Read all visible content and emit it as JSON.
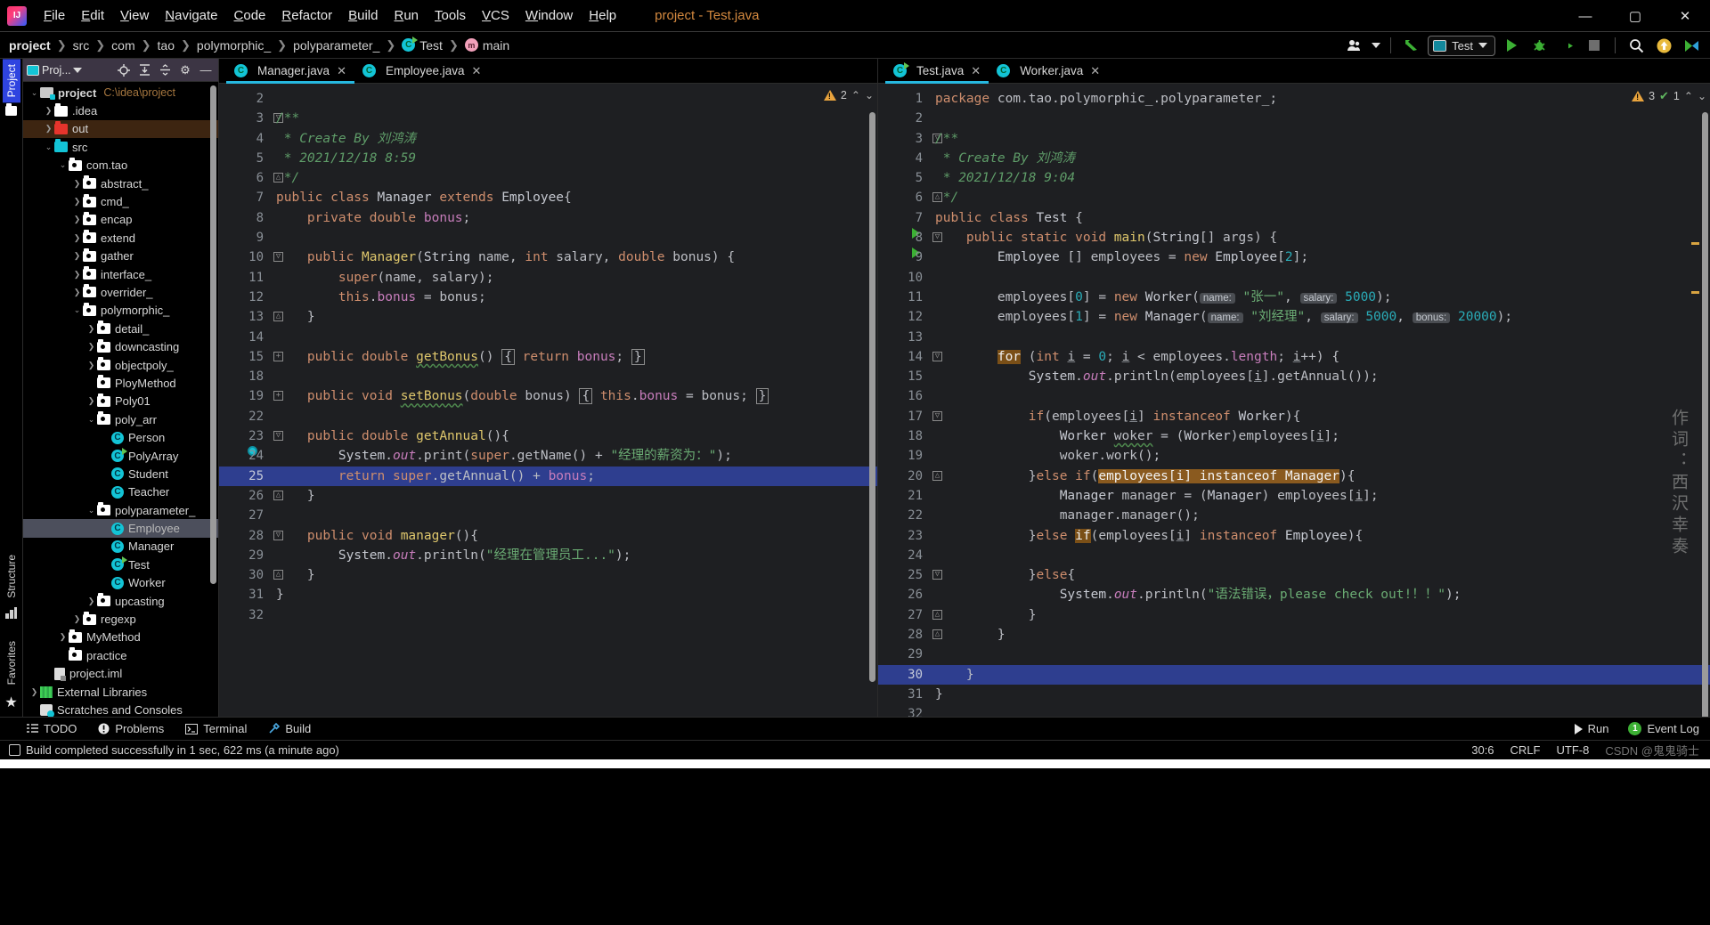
{
  "window": {
    "title": "project - Test.java",
    "app_icon": "intellij-logo",
    "minimize": "—",
    "maximize": "▢",
    "close": "✕"
  },
  "menu": [
    "File",
    "Edit",
    "View",
    "Navigate",
    "Code",
    "Refactor",
    "Build",
    "Run",
    "Tools",
    "VCS",
    "Window",
    "Help"
  ],
  "breadcrumb": [
    "project",
    "src",
    "com",
    "tao",
    "polymorphic_",
    "polyparameter_",
    "Test",
    "main"
  ],
  "toolbar": {
    "vcs_label": "",
    "run_config": "Test",
    "run_button": "run-button",
    "debug_button": "debug-button",
    "coverage_button": "run-with-coverage-button",
    "stop_button": "stop-button",
    "search_button": "search-everywhere-button",
    "update_button": "update-project-button",
    "settings_button": "ide-settings-button"
  },
  "left_strip": {
    "top": [
      "Project"
    ],
    "bottom": [
      "Structure",
      "Favorites"
    ]
  },
  "project_panel": {
    "title": "Proj...",
    "icons": [
      "locate-icon",
      "expand-all-icon",
      "collapse-all-icon",
      "settings-icon",
      "hide-icon"
    ],
    "tree": [
      {
        "label": "project",
        "suffix": "C:\\idea\\project",
        "indent": 0,
        "arrow": "v",
        "icon": "module",
        "state": "normal"
      },
      {
        "label": ".idea",
        "indent": 1,
        "arrow": ">",
        "icon": "folder-plain",
        "state": "normal"
      },
      {
        "label": "out",
        "indent": 1,
        "arrow": ">",
        "icon": "folder-red",
        "state": "selected-out"
      },
      {
        "label": "src",
        "indent": 1,
        "arrow": "v",
        "icon": "folder-cyan",
        "state": "normal"
      },
      {
        "label": "com.tao",
        "indent": 2,
        "arrow": "v",
        "icon": "package",
        "state": "normal"
      },
      {
        "label": "abstract_",
        "indent": 3,
        "arrow": ">",
        "icon": "package",
        "state": "normal"
      },
      {
        "label": "cmd_",
        "indent": 3,
        "arrow": ">",
        "icon": "package",
        "state": "normal"
      },
      {
        "label": "encap",
        "indent": 3,
        "arrow": ">",
        "icon": "package",
        "state": "normal"
      },
      {
        "label": "extend",
        "indent": 3,
        "arrow": ">",
        "icon": "package",
        "state": "normal"
      },
      {
        "label": "gather",
        "indent": 3,
        "arrow": ">",
        "icon": "package",
        "state": "normal"
      },
      {
        "label": "interface_",
        "indent": 3,
        "arrow": ">",
        "icon": "package",
        "state": "normal"
      },
      {
        "label": "overrider_",
        "indent": 3,
        "arrow": ">",
        "icon": "package",
        "state": "normal"
      },
      {
        "label": "polymorphic_",
        "indent": 3,
        "arrow": "v",
        "icon": "package",
        "state": "normal"
      },
      {
        "label": "detail_",
        "indent": 4,
        "arrow": ">",
        "icon": "package",
        "state": "normal"
      },
      {
        "label": "downcasting",
        "indent": 4,
        "arrow": ">",
        "icon": "package",
        "state": "normal"
      },
      {
        "label": "objectpoly_",
        "indent": 4,
        "arrow": ">",
        "icon": "package",
        "state": "normal"
      },
      {
        "label": "PloyMethod",
        "indent": 4,
        "arrow": "",
        "icon": "package",
        "state": "normal"
      },
      {
        "label": "Poly01",
        "indent": 4,
        "arrow": ">",
        "icon": "package",
        "state": "normal"
      },
      {
        "label": "poly_arr",
        "indent": 4,
        "arrow": "v",
        "icon": "package",
        "state": "normal"
      },
      {
        "label": "Person",
        "indent": 5,
        "arrow": "",
        "icon": "class",
        "state": "normal"
      },
      {
        "label": "PolyArray",
        "indent": 5,
        "arrow": "",
        "icon": "class-runnable",
        "state": "normal"
      },
      {
        "label": "Student",
        "indent": 5,
        "arrow": "",
        "icon": "class",
        "state": "normal"
      },
      {
        "label": "Teacher",
        "indent": 5,
        "arrow": "",
        "icon": "class",
        "state": "normal"
      },
      {
        "label": "polyparameter_",
        "indent": 4,
        "arrow": "v",
        "icon": "package",
        "state": "normal"
      },
      {
        "label": "Employee",
        "indent": 5,
        "arrow": "",
        "icon": "class",
        "state": "selected-grey"
      },
      {
        "label": "Manager",
        "indent": 5,
        "arrow": "",
        "icon": "class",
        "state": "normal"
      },
      {
        "label": "Test",
        "indent": 5,
        "arrow": "",
        "icon": "class-runnable",
        "state": "normal"
      },
      {
        "label": "Worker",
        "indent": 5,
        "arrow": "",
        "icon": "class",
        "state": "normal"
      },
      {
        "label": "upcasting",
        "indent": 4,
        "arrow": ">",
        "icon": "package",
        "state": "normal"
      },
      {
        "label": "regexp",
        "indent": 3,
        "arrow": ">",
        "icon": "package",
        "state": "normal"
      },
      {
        "label": "MyMethod",
        "indent": 2,
        "arrow": ">",
        "icon": "package",
        "state": "normal"
      },
      {
        "label": "practice",
        "indent": 2,
        "arrow": "",
        "icon": "package",
        "state": "normal"
      },
      {
        "label": "project.iml",
        "indent": 1,
        "arrow": "",
        "icon": "iml",
        "state": "normal"
      },
      {
        "label": "External Libraries",
        "indent": 0,
        "arrow": ">",
        "icon": "library",
        "state": "normal"
      },
      {
        "label": "Scratches and Consoles",
        "indent": 0,
        "arrow": "",
        "icon": "scratch",
        "state": "normal"
      }
    ]
  },
  "editor_left": {
    "tabs": [
      {
        "label": "Manager.java",
        "icon": "class",
        "active": true
      },
      {
        "label": "Employee.java",
        "icon": "class",
        "active": false
      }
    ],
    "inspection": {
      "warnings": "2",
      "up": "⌃",
      "down": "⌄"
    },
    "current_line": 25,
    "lines": [
      {
        "n": "2",
        "html": ""
      },
      {
        "n": "3",
        "html": "<span class=\"cmt\">/**</span>",
        "fold": "minus"
      },
      {
        "n": "4",
        "html": "<span class=\"cmt\"> * Create By 刘鸿涛</span>"
      },
      {
        "n": "5",
        "html": "<span class=\"cmt\"> * 2021/12/18 8:59</span>"
      },
      {
        "n": "6",
        "html": "<span class=\"cmt\"> */</span>",
        "fold": "end"
      },
      {
        "n": "7",
        "html": "<span class=\"kw\">public class </span><span class=\"cls\">Manager </span><span class=\"kw\">extends </span><span class=\"cls\">Employee</span><span class=\"id\">{</span>"
      },
      {
        "n": "8",
        "html": "    <span class=\"kw\">private double </span><span class=\"fld\">bonus</span><span class=\"id\">;</span>"
      },
      {
        "n": "9",
        "html": ""
      },
      {
        "n": "10",
        "html": "    <span class=\"kw\">public </span><span class=\"mth\">Manager</span><span class=\"id\">(</span><span class=\"cls\">String </span><span class=\"id\">name, </span><span class=\"kw\">int </span><span class=\"id\">salary, </span><span class=\"kw\">double </span><span class=\"id\">bonus) {</span>",
        "fold": "minus"
      },
      {
        "n": "11",
        "html": "        <span class=\"kw\">super</span><span class=\"id\">(name, salary);</span>"
      },
      {
        "n": "12",
        "html": "        <span class=\"kw\">this</span><span class=\"id\">.</span><span class=\"fld\">bonus </span><span class=\"id\">= bonus;</span>"
      },
      {
        "n": "13",
        "html": "    <span class=\"id\">}</span>",
        "fold": "end"
      },
      {
        "n": "14",
        "html": ""
      },
      {
        "n": "15",
        "html": "    <span class=\"kw\">public double </span><span class=\"mth wavy\">getBonus</span><span class=\"id\">() </span><span class=\"brace-box\">{</span><span class=\"kw\"> return </span><span class=\"fld\">bonus</span><span class=\"id\">; </span><span class=\"brace-box\">}</span>",
        "fold": "plus"
      },
      {
        "n": "18",
        "html": ""
      },
      {
        "n": "19",
        "html": "    <span class=\"kw\">public void </span><span class=\"mth wavy\">setBonus</span><span class=\"id\">(</span><span class=\"kw\">double </span><span class=\"id\">bonus) </span><span class=\"brace-box\">{</span><span class=\"kw\"> this</span><span class=\"id\">.</span><span class=\"fld\">bonus </span><span class=\"id\">= bonus; </span><span class=\"brace-box\">}</span>",
        "fold": "plus"
      },
      {
        "n": "22",
        "html": ""
      },
      {
        "n": "23",
        "html": "    <span class=\"kw\">public double </span><span class=\"mth\">getAnnual</span><span class=\"id\">(){</span>",
        "fold": "minus",
        "mark": "override"
      },
      {
        "n": "24",
        "html": "        <span class=\"cls\">System</span><span class=\"id\">.</span><span class=\"stat\">out</span><span class=\"id\">.</span><span class=\"id\">print(</span><span class=\"kw\">super</span><span class=\"id\">.getName() + </span><span class=\"str\">\"经理的薪资为：\"</span><span class=\"id\">);</span>"
      },
      {
        "n": "25",
        "html": "        <span class=\"kw\">return super</span><span class=\"id\">.getAnnual() + </span><span class=\"fld\">bonus</span><span class=\"id\">;</span>",
        "current": true
      },
      {
        "n": "26",
        "html": "    <span class=\"id\">}</span>",
        "fold": "end"
      },
      {
        "n": "27",
        "html": ""
      },
      {
        "n": "28",
        "html": "    <span class=\"kw\">public void </span><span class=\"mth\">manager</span><span class=\"id\">(){</span>",
        "fold": "minus"
      },
      {
        "n": "29",
        "html": "        <span class=\"cls\">System</span><span class=\"id\">.</span><span class=\"stat\">out</span><span class=\"id\">.println(</span><span class=\"str\">\"经理在管理员工...\"</span><span class=\"id\">);</span>"
      },
      {
        "n": "30",
        "html": "    <span class=\"id\">}</span>",
        "fold": "end"
      },
      {
        "n": "31",
        "html": "<span class=\"id\">}</span>"
      },
      {
        "n": "32",
        "html": ""
      }
    ]
  },
  "editor_right": {
    "tabs": [
      {
        "label": "Test.java",
        "icon": "class-runnable",
        "active": true
      },
      {
        "label": "Worker.java",
        "icon": "class",
        "active": false
      }
    ],
    "inspection": {
      "warnings": "3",
      "oks": "1",
      "up": "⌃",
      "down": "⌄"
    },
    "current_line": 30,
    "watermark": "作词：西沢幸奏",
    "lines": [
      {
        "n": "1",
        "html": "<span class=\"kw\">package </span><span class=\"id\">com.tao.polymorphic_.polyparameter_;</span>"
      },
      {
        "n": "2",
        "html": ""
      },
      {
        "n": "3",
        "html": "<span class=\"cmt\">/**</span>",
        "fold": "minus"
      },
      {
        "n": "4",
        "html": "<span class=\"cmt\"> * Create By 刘鸿涛</span>"
      },
      {
        "n": "5",
        "html": "<span class=\"cmt\"> * 2021/12/18 9:04</span>"
      },
      {
        "n": "6",
        "html": "<span class=\"cmt\"> */</span>",
        "fold": "end"
      },
      {
        "n": "7",
        "html": "<span class=\"kw\">public class </span><span class=\"cls\">Test </span><span class=\"id\">{</span>",
        "run": true
      },
      {
        "n": "8",
        "html": "    <span class=\"kw\">public static void </span><span class=\"mth\">main</span><span class=\"id\">(</span><span class=\"cls\">String</span><span class=\"id\">[] args) {</span>",
        "run": true,
        "fold": "minus"
      },
      {
        "n": "9",
        "html": "        <span class=\"cls\">Employee </span><span class=\"id\">[] employees = </span><span class=\"kw\">new </span><span class=\"cls\">Employee</span><span class=\"id\">[</span><span class=\"num\">2</span><span class=\"id\">];</span>"
      },
      {
        "n": "10",
        "html": ""
      },
      {
        "n": "11",
        "html": "        <span class=\"id\">employees[</span><span class=\"num\">0</span><span class=\"id\">] = </span><span class=\"kw\">new </span><span class=\"cls\">Worker</span><span class=\"id\">(</span><span class=\"param-hint\">name:</span><span class=\"str\"> \"张一\"</span><span class=\"id\">, </span><span class=\"param-hint\">salary:</span><span class=\"num\"> 5000</span><span class=\"id\">);</span>"
      },
      {
        "n": "12",
        "html": "        <span class=\"id\">employees[</span><span class=\"num\">1</span><span class=\"id\">] = </span><span class=\"kw\">new </span><span class=\"cls\">Manager</span><span class=\"id\">(</span><span class=\"param-hint\">name:</span><span class=\"str\"> \"刘经理\"</span><span class=\"id\">, </span><span class=\"param-hint\">salary:</span><span class=\"num\"> 5000</span><span class=\"id\">, </span><span class=\"param-hint\">bonus:</span><span class=\"num\"> 20000</span><span class=\"id\">);</span>"
      },
      {
        "n": "13",
        "html": ""
      },
      {
        "n": "14",
        "html": "        <span class=\"hl-for\">for</span><span class=\"id\"> (</span><span class=\"kw\">int </span><span class=\"id underl\">i</span><span class=\"id\"> = </span><span class=\"num\">0</span><span class=\"id\">; </span><span class=\"id underl\">i</span><span class=\"id\"> &lt; employees.</span><span class=\"fld\">length</span><span class=\"id\">; </span><span class=\"id underl\">i</span><span class=\"id\">++) {</span>",
        "fold": "minus"
      },
      {
        "n": "15",
        "html": "            <span class=\"cls\">System</span><span class=\"id\">.</span><span class=\"stat\">out</span><span class=\"id\">.println(employees[</span><span class=\"id underl\">i</span><span class=\"id\">].getAnnual());</span>"
      },
      {
        "n": "16",
        "html": ""
      },
      {
        "n": "17",
        "html": "            <span class=\"kw\">if</span><span class=\"id\">(employees[</span><span class=\"id underl\">i</span><span class=\"id\">] </span><span class=\"kw\">instanceof </span><span class=\"cls\">Worker</span><span class=\"id\">){</span>",
        "fold": "minus"
      },
      {
        "n": "18",
        "html": "                <span class=\"cls\">Worker </span><span class=\"id wavy\">woker</span><span class=\"id\"> = (</span><span class=\"cls\">Worker</span><span class=\"id\">)employees[</span><span class=\"id underl\">i</span><span class=\"id\">];</span>"
      },
      {
        "n": "19",
        "html": "                <span class=\"id\">woker.work();</span>"
      },
      {
        "n": "20",
        "html": "            <span class=\"id\">}</span><span class=\"kw\">else if</span><span class=\"id\">(</span><span class=\"hl-sel\">employees[i] instanceof Manager</span><span class=\"id\">){</span>",
        "fold": "end"
      },
      {
        "n": "21",
        "html": "                <span class=\"cls\">Manager </span><span class=\"id\">manager = (</span><span class=\"cls\">Manager</span><span class=\"id\">) employees[</span><span class=\"id underl\">i</span><span class=\"id\">];</span>"
      },
      {
        "n": "22",
        "html": "                <span class=\"id\">manager.manager();</span>"
      },
      {
        "n": "23",
        "html": "            <span class=\"id\">}</span><span class=\"kw\">else </span><span class=\"hl-for\">if</span><span class=\"id\">(employees[</span><span class=\"id underl\">i</span><span class=\"id\">] </span><span class=\"kw\">instanceof </span><span class=\"cls\">Employee</span><span class=\"id\">){</span>"
      },
      {
        "n": "24",
        "html": ""
      },
      {
        "n": "25",
        "html": "            <span class=\"id\">}</span><span class=\"kw\">else</span><span class=\"id\">{</span>",
        "fold": "minus"
      },
      {
        "n": "26",
        "html": "                <span class=\"cls\">System</span><span class=\"id\">.</span><span class=\"stat\">out</span><span class=\"id\">.println(</span><span class=\"str\">\"语法错误，please check out!！！\"</span><span class=\"id\">);</span>"
      },
      {
        "n": "27",
        "html": "            <span class=\"id\">}</span>",
        "fold": "end"
      },
      {
        "n": "28",
        "html": "        <span class=\"id\">}</span>",
        "fold": "end"
      },
      {
        "n": "29",
        "html": ""
      },
      {
        "n": "30",
        "html": "    <span class=\"id\">}</span>",
        "current": true,
        "fold": "end"
      },
      {
        "n": "31",
        "html": "<span class=\"id\">}</span>"
      },
      {
        "n": "32",
        "html": ""
      }
    ]
  },
  "tool_windows": {
    "left": [
      {
        "label": "TODO",
        "icon": "todo-icon"
      },
      {
        "label": "Problems",
        "icon": "problems-icon"
      },
      {
        "label": "Terminal",
        "icon": "terminal-icon"
      },
      {
        "label": "Build",
        "icon": "build-icon"
      }
    ],
    "right": [
      {
        "label": "Run",
        "icon": "run-icon"
      },
      {
        "label": "Event Log",
        "icon": "event-log-icon",
        "badge": "1"
      }
    ]
  },
  "status_bar": {
    "message": "Build completed successfully in 1 sec, 622 ms (a minute ago)",
    "caret": "30:6",
    "line_separator": "CRLF",
    "encoding": "UTF-8",
    "watermark": "CSDN @鬼鬼骑士"
  },
  "colors": {
    "accent": "#26b8e0",
    "warning": "#e8a33d",
    "run_green": "#3cb034",
    "selection_blue": "#2e3e8f",
    "highlight_brown": "#7a4f17",
    "title_orange": "#d4893f"
  }
}
